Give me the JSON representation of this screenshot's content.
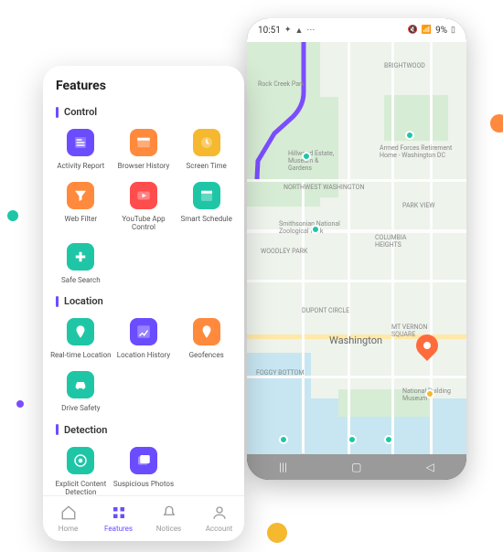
{
  "decor": {
    "dots": [
      "orange",
      "teal",
      "purple",
      "yellow"
    ]
  },
  "mapPhone": {
    "statusbar": {
      "time": "10:51",
      "batteryText": "9%"
    },
    "city_label": "Washington",
    "labels": {
      "brightwood": "BRIGHTWOOD",
      "parkview": "PARK VIEW",
      "columbia": "COLUMBIA HEIGHTS",
      "northwest": "NORTHWEST WASHINGTON",
      "woodley": "WOODLEY PARK",
      "dupont": "DUPONT CIRCLE",
      "foggy": "FOGGY BOTTOM",
      "mtvernon": "MT VERNON SQUARE",
      "rockcreek": "Rock Creek Park",
      "hillwood": "Hillwood Estate, Museum & Gardens",
      "airforce": "Armed Forces Retirement Home - Washington DC",
      "zoo": "Smithsonian National Zoological Park",
      "natbuild": "National Building Museum"
    }
  },
  "featuresPhone": {
    "title": "Features",
    "sections": [
      {
        "title": "Control",
        "items": [
          {
            "id": "activity-report",
            "label": "Activity Report",
            "icon": "report",
            "color": "purple"
          },
          {
            "id": "browser-history",
            "label": "Browser History",
            "icon": "browser",
            "color": "orange"
          },
          {
            "id": "screen-time",
            "label": "Screen Time",
            "icon": "clock",
            "color": "yellow"
          },
          {
            "id": "web-filter",
            "label": "Web Filter",
            "icon": "filter",
            "color": "orange"
          },
          {
            "id": "youtube",
            "label": "YouTube App Control",
            "icon": "play",
            "color": "red"
          },
          {
            "id": "smart-schedule",
            "label": "Smart Schedule",
            "icon": "calendar",
            "color": "teal"
          },
          {
            "id": "safe-search",
            "label": "Safe Search",
            "icon": "plus",
            "color": "teal"
          }
        ]
      },
      {
        "title": "Location",
        "items": [
          {
            "id": "realtime-loc",
            "label": "Real-time Location",
            "icon": "pin",
            "color": "teal"
          },
          {
            "id": "loc-history",
            "label": "Location History",
            "icon": "maproute",
            "color": "purple"
          },
          {
            "id": "geofences",
            "label": "Geofences",
            "icon": "geofence",
            "color": "orange"
          },
          {
            "id": "drive-safety",
            "label": "Drive Safety",
            "icon": "car",
            "color": "teal"
          }
        ]
      },
      {
        "title": "Detection",
        "items": [
          {
            "id": "explicit",
            "label": "Explicit Content Detection",
            "icon": "target",
            "color": "teal"
          },
          {
            "id": "suspicious",
            "label": "Suspicious Photos",
            "icon": "photos",
            "color": "purple"
          }
        ]
      }
    ],
    "tabs": [
      {
        "id": "home",
        "label": "Home",
        "icon": "home"
      },
      {
        "id": "features",
        "label": "Features",
        "icon": "grid",
        "active": true
      },
      {
        "id": "notices",
        "label": "Notices",
        "icon": "bell"
      },
      {
        "id": "account",
        "label": "Account",
        "icon": "user"
      }
    ]
  }
}
